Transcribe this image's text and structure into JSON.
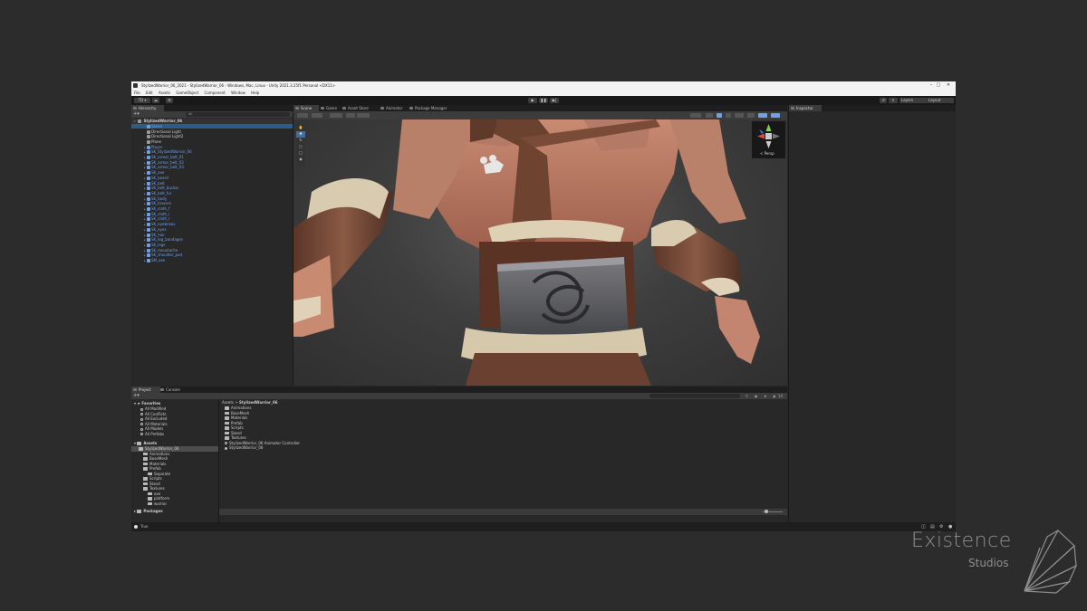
{
  "window": {
    "title": "StylizedWarrior_06_2021 - StylizedWarrior_06 - Windows, Mac, Linux - Unity 2021.3.25f1 Personal <DX11>",
    "controls": [
      "–",
      "□",
      "✕"
    ]
  },
  "menu": [
    "File",
    "Edit",
    "Assets",
    "GameObject",
    "Component",
    "Window",
    "Help"
  ],
  "toolbar": {
    "account_label": "TD ▾",
    "layers_label": "Layers",
    "layout_label": "Layout"
  },
  "hierarchy": {
    "tab": "Hierarchy",
    "search_placeholder": "All",
    "scene_name": "StylizedWarrior_06",
    "items": [
      {
        "label": "Stand",
        "color": "blue",
        "depth": 1,
        "selected": true
      },
      {
        "label": "Directional Light",
        "color": "white",
        "depth": 1
      },
      {
        "label": "Directional Light2",
        "color": "white",
        "depth": 1
      },
      {
        "label": "Plane",
        "color": "white",
        "depth": 1
      },
      {
        "label": "Player",
        "color": "blue",
        "depth": 1,
        "expand": true
      },
      {
        "label": "SK_StylizedWarrior_06",
        "color": "blue",
        "depth": 1,
        "expand": true
      },
      {
        "label": "SK_armor_belt_01",
        "color": "blue",
        "depth": 1,
        "expand": true
      },
      {
        "label": "SK_armor_belt_02",
        "color": "blue",
        "depth": 1,
        "expand": true
      },
      {
        "label": "SK_armor_belt_03",
        "color": "blue",
        "depth": 1,
        "expand": true
      },
      {
        "label": "SK_axe",
        "color": "blue",
        "depth": 1,
        "expand": true
      },
      {
        "label": "SK_beard",
        "color": "blue",
        "depth": 1,
        "expand": true
      },
      {
        "label": "SK_belt",
        "color": "blue",
        "depth": 1,
        "expand": true
      },
      {
        "label": "SK_belt_buckle",
        "color": "blue",
        "depth": 1,
        "expand": true
      },
      {
        "label": "SK_belt_fur",
        "color": "blue",
        "depth": 1,
        "expand": true
      },
      {
        "label": "SK_body",
        "color": "blue",
        "depth": 1,
        "expand": true
      },
      {
        "label": "SK_bracers",
        "color": "blue",
        "depth": 1,
        "expand": true
      },
      {
        "label": "SK_cloth_f",
        "color": "blue",
        "depth": 1,
        "expand": true
      },
      {
        "label": "SK_cloth_l",
        "color": "blue",
        "depth": 1,
        "expand": true
      },
      {
        "label": "SK_cloth_r",
        "color": "blue",
        "depth": 1,
        "expand": true
      },
      {
        "label": "SK_eyebrows",
        "color": "blue",
        "depth": 1,
        "expand": true
      },
      {
        "label": "SK_eyes",
        "color": "blue",
        "depth": 1,
        "expand": true
      },
      {
        "label": "SK_hair",
        "color": "blue",
        "depth": 1,
        "expand": true
      },
      {
        "label": "SK_leg_bandages",
        "color": "blue",
        "depth": 1,
        "expand": true
      },
      {
        "label": "SK_legs",
        "color": "blue",
        "depth": 1,
        "expand": true
      },
      {
        "label": "SK_moustache",
        "color": "blue",
        "depth": 1,
        "expand": true
      },
      {
        "label": "SK_shoulder_pad",
        "color": "blue",
        "depth": 1,
        "expand": true
      },
      {
        "label": "SM_axe",
        "color": "blue",
        "depth": 1,
        "expand": true
      }
    ]
  },
  "scene_tabs": [
    "Scene",
    "Game",
    "Asset Store",
    "Animator",
    "Package Manager"
  ],
  "gizmo": {
    "persp_label": "< Persp"
  },
  "inspector": {
    "tab": "Inspector"
  },
  "project": {
    "tabs": [
      "Project",
      "Console"
    ],
    "badge": "14",
    "favorites": {
      "title": "Favorites",
      "items": [
        "All Modified",
        "All Conflicts",
        "All Excluded",
        "All Materials",
        "All Models",
        "All Prefabs"
      ]
    },
    "assets_tree": {
      "title": "Assets",
      "items": [
        {
          "label": "StylizedWarrior_06",
          "depth": 1,
          "selected": true
        },
        {
          "label": "Animations",
          "depth": 2
        },
        {
          "label": "BaseMesh",
          "depth": 2
        },
        {
          "label": "Materials",
          "depth": 2
        },
        {
          "label": "Prefab",
          "depth": 2
        },
        {
          "label": "Separate",
          "depth": 3
        },
        {
          "label": "Scripts",
          "depth": 2
        },
        {
          "label": "Stand",
          "depth": 2
        },
        {
          "label": "Textures",
          "depth": 2
        },
        {
          "label": "axe",
          "depth": 3
        },
        {
          "label": "platform",
          "depth": 3
        },
        {
          "label": "warrior",
          "depth": 3
        }
      ]
    },
    "packages_title": "Packages",
    "breadcrumb": [
      "Assets",
      "StylizedWarrior_06"
    ],
    "breadcrumb_sep": ">",
    "files": [
      {
        "label": "Animations",
        "kind": "folder"
      },
      {
        "label": "BaseMesh",
        "kind": "folder"
      },
      {
        "label": "Materials",
        "kind": "folder"
      },
      {
        "label": "Prefab",
        "kind": "folder"
      },
      {
        "label": "Scripts",
        "kind": "folder"
      },
      {
        "label": "Stand",
        "kind": "folder"
      },
      {
        "label": "Textures",
        "kind": "folder"
      },
      {
        "label": "StylizedWarrior_06 Animator Controller",
        "kind": "controller"
      },
      {
        "label": "StylizedWarrior_06",
        "kind": "scene"
      }
    ]
  },
  "status": {
    "text": "True"
  },
  "watermark": {
    "name": "Existence",
    "sub": "Studios"
  },
  "colors": {
    "accent_blue": "#6fa0e8",
    "selection": "#2c5d87",
    "panel": "#282828",
    "header": "#1e1e1e"
  }
}
